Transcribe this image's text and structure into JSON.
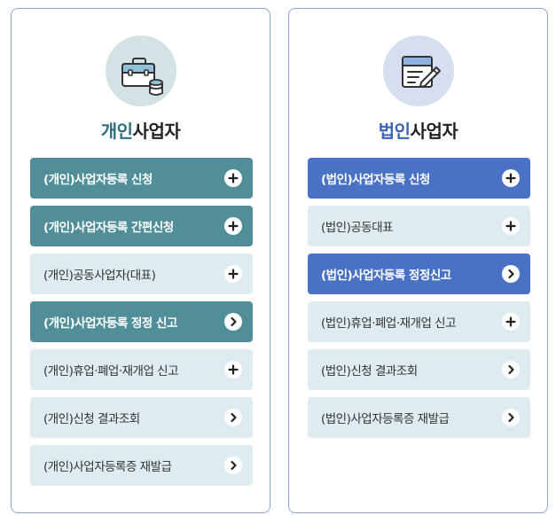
{
  "colors": {
    "personal_accent": "#508f99",
    "personal_title_accent": "#2f6f7c",
    "corporate_accent": "#4a72c4",
    "corporate_title_accent": "#3d62b3",
    "light_button": "#deebf1",
    "panel_border": "#8fa6cf"
  },
  "personal": {
    "icon": "briefcase-coins-icon",
    "title_accent": "개인",
    "title_rest": "사업자",
    "buttons": [
      {
        "label": "(개인)사업자등록 신청",
        "style": "dark",
        "icon": "plus-icon"
      },
      {
        "label": "(개인)사업자등록 간편신청",
        "style": "dark",
        "icon": "plus-icon"
      },
      {
        "label": "(개인)공동사업자(대표)",
        "style": "light",
        "icon": "plus-icon"
      },
      {
        "label": "(개인)사업자등록 정정 신고",
        "style": "dark",
        "icon": "chevron-right-icon"
      },
      {
        "label": "(개인)휴업·폐업·재개업 신고",
        "style": "light",
        "icon": "plus-icon"
      },
      {
        "label": "(개인)신청 결과조회",
        "style": "light",
        "icon": "chevron-right-icon"
      },
      {
        "label": "(개인)사업자등록증 재발급",
        "style": "light",
        "icon": "chevron-right-icon"
      }
    ]
  },
  "corporate": {
    "icon": "document-pen-icon",
    "title_accent": "법인",
    "title_rest": "사업자",
    "buttons": [
      {
        "label": "(법인)사업자등록 신청",
        "style": "dark",
        "icon": "plus-icon"
      },
      {
        "label": "(법인)공동대표",
        "style": "light",
        "icon": "plus-icon"
      },
      {
        "label": "(법인)사업자등록 정정신고",
        "style": "dark",
        "icon": "chevron-right-icon"
      },
      {
        "label": "(법인)휴업·폐업·재개업 신고",
        "style": "light",
        "icon": "plus-icon"
      },
      {
        "label": "(법인)신청 결과조회",
        "style": "light",
        "icon": "chevron-right-icon"
      },
      {
        "label": "(법인)사업자등록증 재발급",
        "style": "light",
        "icon": "chevron-right-icon"
      }
    ]
  }
}
